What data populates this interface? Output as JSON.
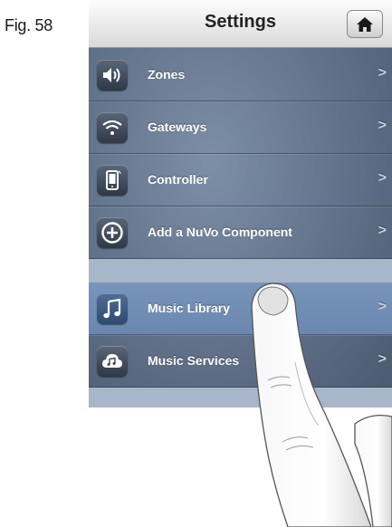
{
  "figure_label": "Fig. 58",
  "header": {
    "title": "Settings",
    "home_icon": "home-icon"
  },
  "menu": [
    {
      "label": "Zones",
      "icon": "speaker-icon",
      "chevron": ">"
    },
    {
      "label": "Gateways",
      "icon": "wifi-icon",
      "chevron": ">"
    },
    {
      "label": "Controller",
      "icon": "phone-icon",
      "chevron": ">"
    },
    {
      "label": "Add a NuVo Component",
      "icon": "plus-circle-icon",
      "chevron": ">"
    }
  ],
  "music_menu": [
    {
      "label": "Music Library",
      "icon": "music-note-icon",
      "chevron": ">",
      "highlighted": true
    },
    {
      "label": "Music Services",
      "icon": "cloud-music-icon",
      "chevron": ">"
    }
  ]
}
